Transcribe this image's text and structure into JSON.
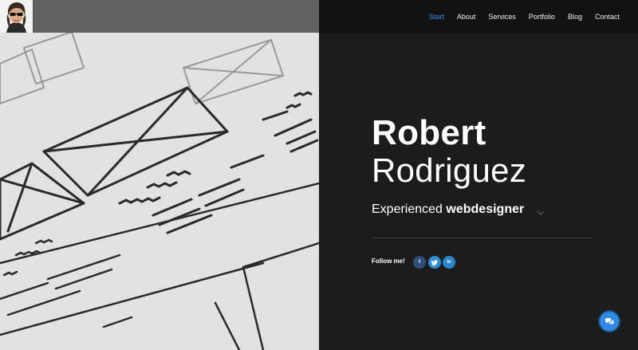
{
  "header": {
    "avatar_alt": "profile avatar",
    "nav": [
      {
        "label": "Start",
        "active": true
      },
      {
        "label": "About",
        "active": false
      },
      {
        "label": "Services",
        "active": false
      },
      {
        "label": "Portfolio",
        "active": false
      },
      {
        "label": "Blog",
        "active": false
      },
      {
        "label": "Contact",
        "active": false
      }
    ]
  },
  "hero": {
    "first_name": "Robert",
    "last_name": "Rodriguez",
    "tagline_prefix": "Experienced",
    "tagline_strong": "webdesigner",
    "follow_label": "Follow me!",
    "social": [
      {
        "icon": "facebook-icon",
        "glyph": "f"
      },
      {
        "icon": "twitter-icon",
        "glyph": "t"
      },
      {
        "icon": "linkedin-icon",
        "glyph": "in"
      }
    ]
  },
  "colors": {
    "accent": "#3a8ff0",
    "panel_dark": "#1c1c1c",
    "chat_button": "#2f8be6"
  }
}
